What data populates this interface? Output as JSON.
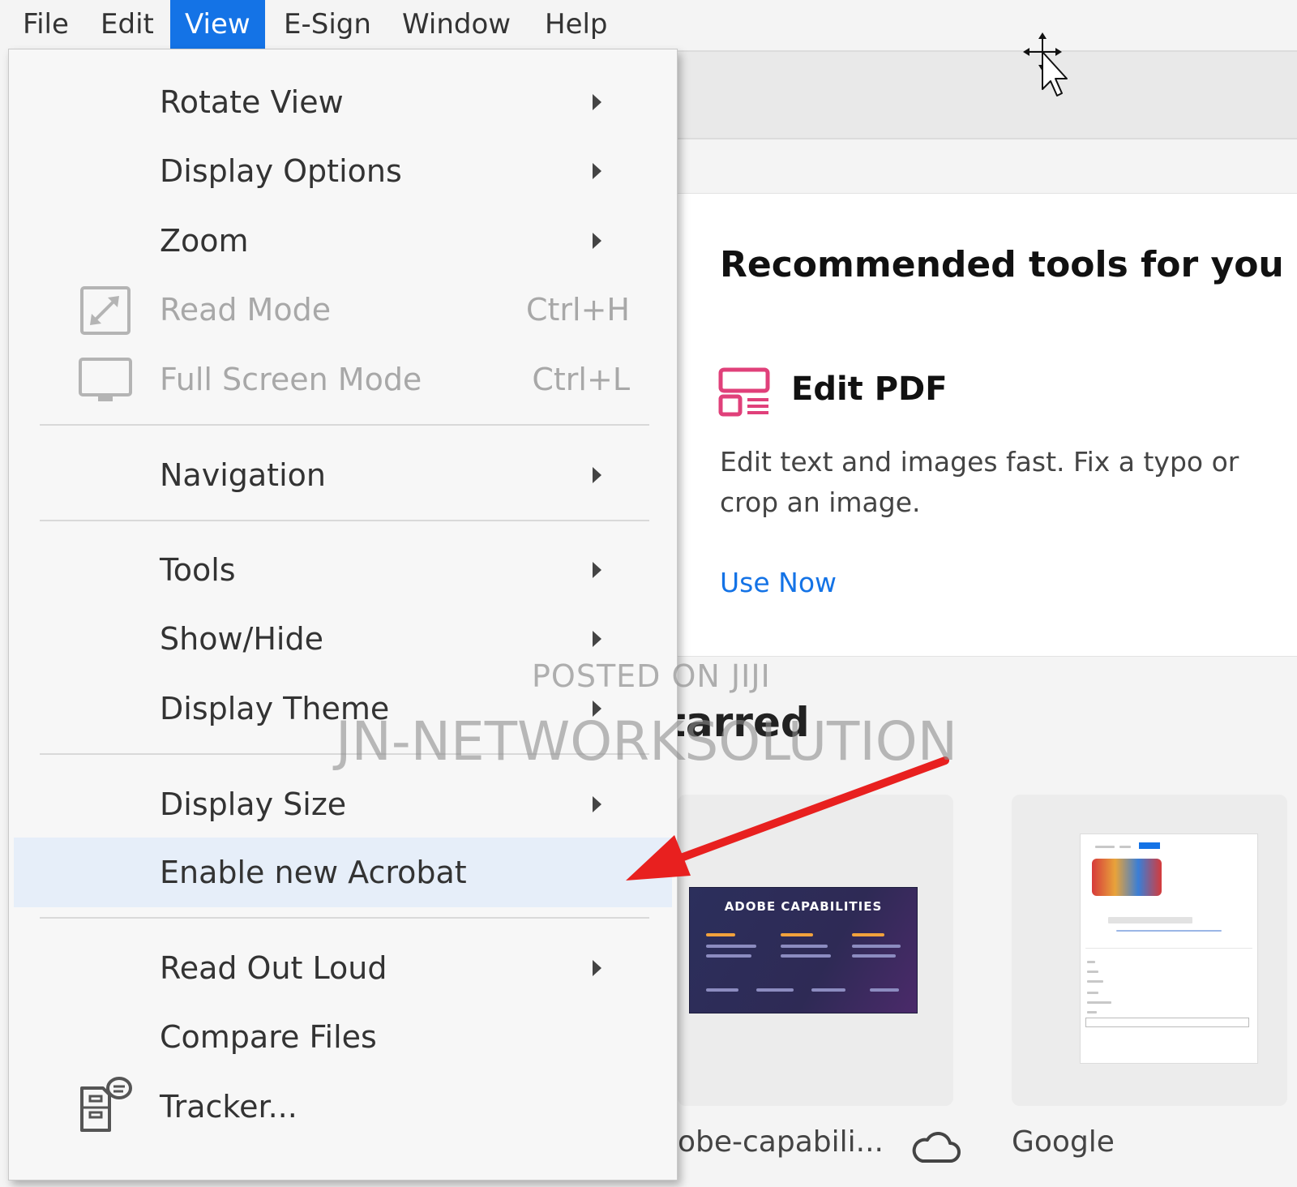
{
  "menubar": {
    "items": [
      {
        "label": "File"
      },
      {
        "label": "Edit"
      },
      {
        "label": "View",
        "active": true
      },
      {
        "label": "E-Sign"
      },
      {
        "label": "Window"
      },
      {
        "label": "Help"
      }
    ]
  },
  "view_menu": {
    "items": [
      {
        "label": "Rotate View",
        "submenu": true
      },
      {
        "label": "Display Options",
        "submenu": true
      },
      {
        "label": "Zoom",
        "submenu": true
      },
      {
        "label": "Read Mode",
        "shortcut": "Ctrl+H",
        "disabled": true,
        "icon": "read-mode-icon"
      },
      {
        "label": "Full Screen Mode",
        "shortcut": "Ctrl+L",
        "disabled": true,
        "icon": "monitor-icon"
      },
      {
        "label": "Navigation",
        "submenu": true
      },
      {
        "label": "Tools",
        "submenu": true
      },
      {
        "label": "Show/Hide",
        "submenu": true
      },
      {
        "label": "Display Theme",
        "submenu": true
      },
      {
        "label": "Display Size",
        "submenu": true
      },
      {
        "label": "Enable new Acrobat",
        "highlighted": true
      },
      {
        "label": "Read Out Loud",
        "submenu": true
      },
      {
        "label": "Compare Files"
      },
      {
        "label": "Tracker...",
        "icon": "tracker-icon"
      }
    ]
  },
  "home": {
    "recommended_title": "Recommended tools for you",
    "tool": {
      "name": "Edit PDF",
      "description": "Edit text and images fast. Fix a typo or crop an image.",
      "link_label": "Use Now",
      "icon": "edit-pdf-icon",
      "icon_color": "#e0407a"
    },
    "starred_heading": "tarred",
    "files": [
      {
        "name": "obe-capabili...",
        "thumbnail_title": "ADOBE CAPABILITIES",
        "cloud": true
      },
      {
        "name": "Google"
      }
    ]
  },
  "overlay": {
    "watermark_small": "POSTED ON JIJI",
    "watermark_big": "JN-NETWORKSOLUTION",
    "arrow_color": "#e8201f"
  },
  "colors": {
    "accent": "#1473e6",
    "menu_highlight": "#e6eef9"
  }
}
